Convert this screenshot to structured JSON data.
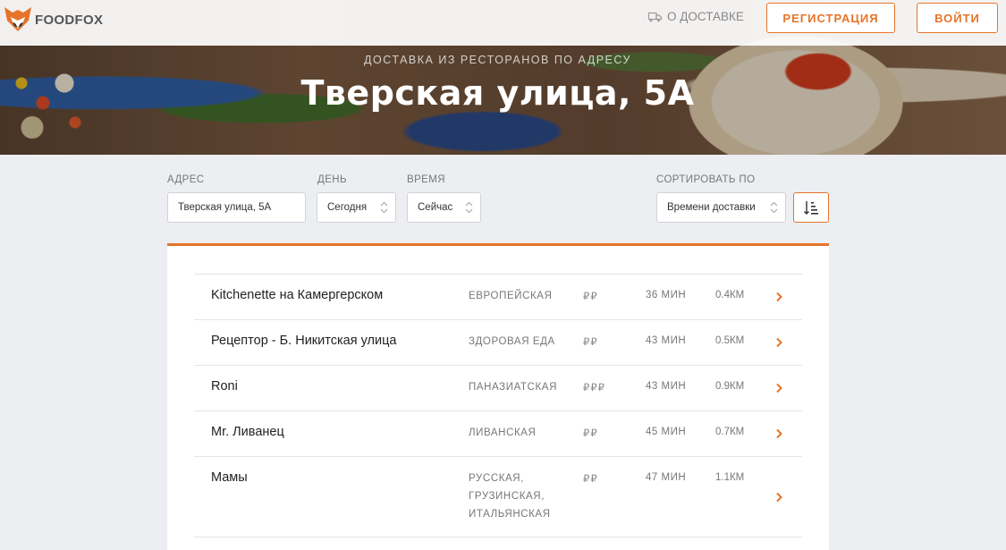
{
  "brand": {
    "name": "FOODFOX",
    "accent": "#e6742a"
  },
  "header": {
    "delivery_link": "О ДОСТАВКЕ",
    "delivery_icon": "truck-icon",
    "register_label": "РЕГИСТРАЦИЯ",
    "login_label": "ВОЙТИ"
  },
  "hero": {
    "subtitle": "ДОСТАВКА ИЗ РЕСТОРАНОВ ПО АДРЕСУ",
    "title": "Тверская улица, 5А"
  },
  "filters": {
    "address_label": "АДРЕС",
    "address_value": "Тверская улица, 5А",
    "day_label": "ДЕНЬ",
    "day_value": "Сегодня",
    "time_label": "ВРЕМЯ",
    "time_value": "Сейчас",
    "sort_label": "СОРТИРОВАТЬ ПО",
    "sort_value": "Времени доставки",
    "sort_order_icon": "sort-ascending-icon"
  },
  "restaurants": [
    {
      "name": "Kitchenette на Камергерском",
      "cuisine": [
        "ЕВРОПЕЙСКАЯ"
      ],
      "price": "₽₽",
      "time": "36 МИН",
      "distance": "0.4КМ"
    },
    {
      "name": "Рецептор - Б. Никитская улица",
      "cuisine": [
        "ЗДОРОВАЯ ЕДА"
      ],
      "price": "₽₽",
      "time": "43 МИН",
      "distance": "0.5КМ"
    },
    {
      "name": "Roni",
      "cuisine": [
        "ПАНАЗИАТСКАЯ"
      ],
      "price": "₽₽₽",
      "time": "43 МИН",
      "distance": "0.9КМ"
    },
    {
      "name": "Mr. Ливанец",
      "cuisine": [
        "ЛИВАНСКАЯ"
      ],
      "price": "₽₽",
      "time": "45 МИН",
      "distance": "0.7КМ"
    },
    {
      "name": "Мамы",
      "cuisine": [
        "РУССКАЯ,",
        "ГРУЗИНСКАЯ,",
        "ИТАЛЬЯНСКАЯ"
      ],
      "price": "₽₽",
      "time": "47 МИН",
      "distance": "1.1КМ"
    }
  ]
}
